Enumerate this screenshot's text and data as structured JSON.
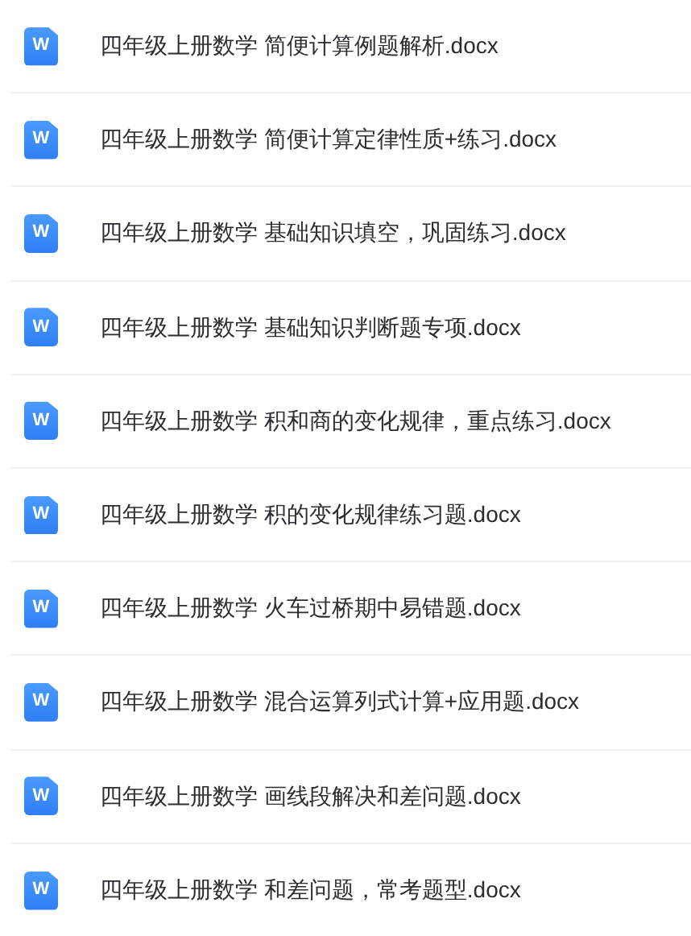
{
  "files": [
    {
      "icon_letter": "W",
      "name": "四年级上册数学 简便计算例题解析.docx"
    },
    {
      "icon_letter": "W",
      "name": "四年级上册数学 简便计算定律性质+练习.docx"
    },
    {
      "icon_letter": "W",
      "name": "四年级上册数学 基础知识填空，巩固练习.docx"
    },
    {
      "icon_letter": "W",
      "name": "四年级上册数学 基础知识判断题专项.docx"
    },
    {
      "icon_letter": "W",
      "name": "四年级上册数学 积和商的变化规律，重点练习.docx"
    },
    {
      "icon_letter": "W",
      "name": "四年级上册数学 积的变化规律练习题.docx"
    },
    {
      "icon_letter": "W",
      "name": "四年级上册数学 火车过桥期中易错题.docx"
    },
    {
      "icon_letter": "W",
      "name": "四年级上册数学 混合运算列式计算+应用题.docx"
    },
    {
      "icon_letter": "W",
      "name": "四年级上册数学 画线段解决和差问题.docx"
    },
    {
      "icon_letter": "W",
      "name": "四年级上册数学 和差问题，常考题型.docx"
    }
  ]
}
